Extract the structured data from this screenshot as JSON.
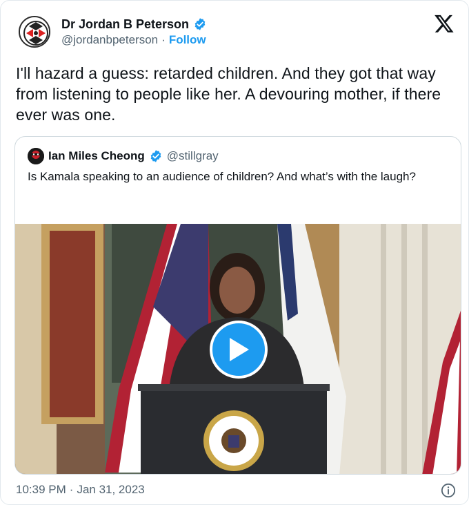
{
  "author": {
    "name": "Dr Jordan B Peterson",
    "handle": "@jordanbpeterson",
    "separator": "·",
    "follow_label": "Follow"
  },
  "tweet": {
    "text": "I'll hazard a guess:  retarded children. And they got that way from listening to people like her. A devouring mother, if there ever was one."
  },
  "quoted": {
    "name": "Ian Miles Cheong",
    "handle": "@stillgray",
    "text": "Is Kamala speaking to an audience of children? And what’s with the laugh?"
  },
  "media": {
    "seal_text": "VICE PRESIDENT OF THE UNITED STATES"
  },
  "footer": {
    "time": "10:39 PM",
    "separator": "·",
    "date": "Jan 31, 2023"
  },
  "colors": {
    "accent": "#1d9bf0",
    "text": "#0f1419",
    "muted": "#536471",
    "border": "#cfd9de"
  },
  "icons": {
    "verified": "verified-badge-icon",
    "platform": "x-logo-icon",
    "play": "play-icon",
    "info": "info-icon"
  }
}
